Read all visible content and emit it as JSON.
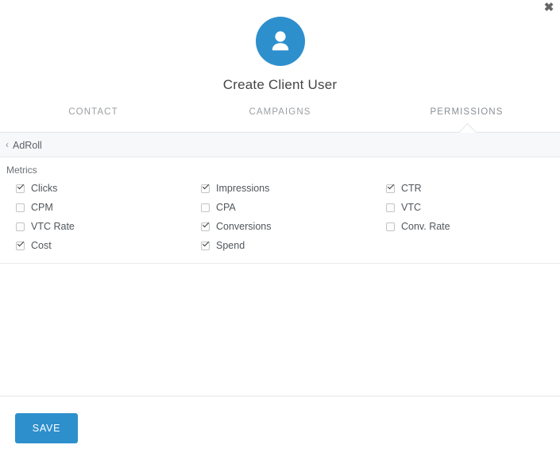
{
  "window": {
    "close_label": "✖"
  },
  "header": {
    "avatar_icon": "user-avatar-icon",
    "title": "Create Client User",
    "avatar_color": "#2e8fcd"
  },
  "tabs": [
    {
      "label": "CONTACT",
      "active": false
    },
    {
      "label": "CAMPAIGNS",
      "active": false
    },
    {
      "label": "PERMISSIONS",
      "active": true
    }
  ],
  "breadcrumb": {
    "back_icon": "‹",
    "label": "AdRoll"
  },
  "metrics": {
    "section_label": "Metrics",
    "columns": [
      [
        {
          "label": "Clicks",
          "checked": true
        },
        {
          "label": "CPM",
          "checked": false
        },
        {
          "label": "VTC Rate",
          "checked": false
        },
        {
          "label": "Cost",
          "checked": true
        }
      ],
      [
        {
          "label": "Impressions",
          "checked": true
        },
        {
          "label": "CPA",
          "checked": false
        },
        {
          "label": "Conversions",
          "checked": true
        },
        {
          "label": "Spend",
          "checked": true
        }
      ],
      [
        {
          "label": "CTR",
          "checked": true
        },
        {
          "label": "VTC",
          "checked": false
        },
        {
          "label": "Conv. Rate",
          "checked": false
        }
      ]
    ]
  },
  "footer": {
    "save_label": "SAVE",
    "save_color": "#2e8fcd"
  }
}
